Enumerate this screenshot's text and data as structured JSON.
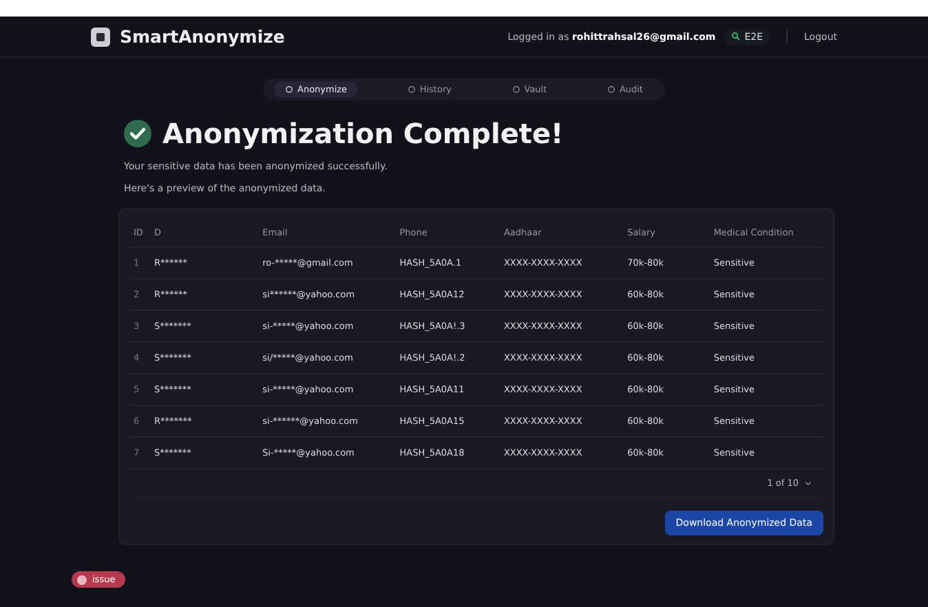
{
  "header": {
    "app_name": "SmartAnonymize",
    "logged_in_prefix": "Logged in as",
    "user_email": "rohittrahsal26@gmail.com",
    "env_badge": "E2E",
    "logout": "Logout"
  },
  "tabs": [
    {
      "label": "Anonymize",
      "selected": true
    },
    {
      "label": "History",
      "selected": false
    },
    {
      "label": "Vault",
      "selected": false
    },
    {
      "label": "Audit",
      "selected": false
    }
  ],
  "title": "Anonymization Complete!",
  "messages": [
    "Your sensitive data has been anonymized successfully.",
    "Here's a preview of the anonymized data."
  ],
  "table": {
    "columns": [
      "ID",
      "D",
      "Email",
      "Phone",
      "Aadhaar",
      "Salary",
      "Medical Condition"
    ],
    "rows": [
      [
        "1",
        "R******",
        "ro-*****@gmail.com",
        "HASH_5A0A.1",
        "XXXX-XXXX-XXXX",
        "70k-80k",
        "Sensitive"
      ],
      [
        "2",
        "R******",
        "si******@yahoo.com",
        "HASH_5A0A12",
        "XXXX-XXXX-XXXX",
        "60k-80k",
        "Sensitive"
      ],
      [
        "3",
        "S*******",
        "si-*****@yahoo.com",
        "HASH_5A0A!.3",
        "XXXX-XXXX-XXXX",
        "60k-80k",
        "Sensitive"
      ],
      [
        "4",
        "S*******",
        "si/*****@yahoo.com",
        "HASH_5A0A!.2",
        "XXXX-XXXX-XXXX",
        "60k-80k",
        "Sensitive"
      ],
      [
        "5",
        "S*******",
        "si-*****@yahoo.com",
        "HASH_5A0A11",
        "XXXX-XXXX-XXXX",
        "60k-80k",
        "Sensitive"
      ],
      [
        "6",
        "R*******",
        "si-******@yahoo.com",
        "HASH_5A0A15",
        "XXXX-XXXX-XXXX",
        "60k-80k",
        "Sensitive"
      ],
      [
        "7",
        "S*******",
        "Si-*****@yahoo.com",
        "HASH_5A0A18",
        "XXXX-XXXX-XXXX",
        "60k-80k",
        "Sensitive"
      ]
    ]
  },
  "pagination": "1 of 10",
  "download_button": "Download Anonymized Data",
  "issue_badge": "issue"
}
